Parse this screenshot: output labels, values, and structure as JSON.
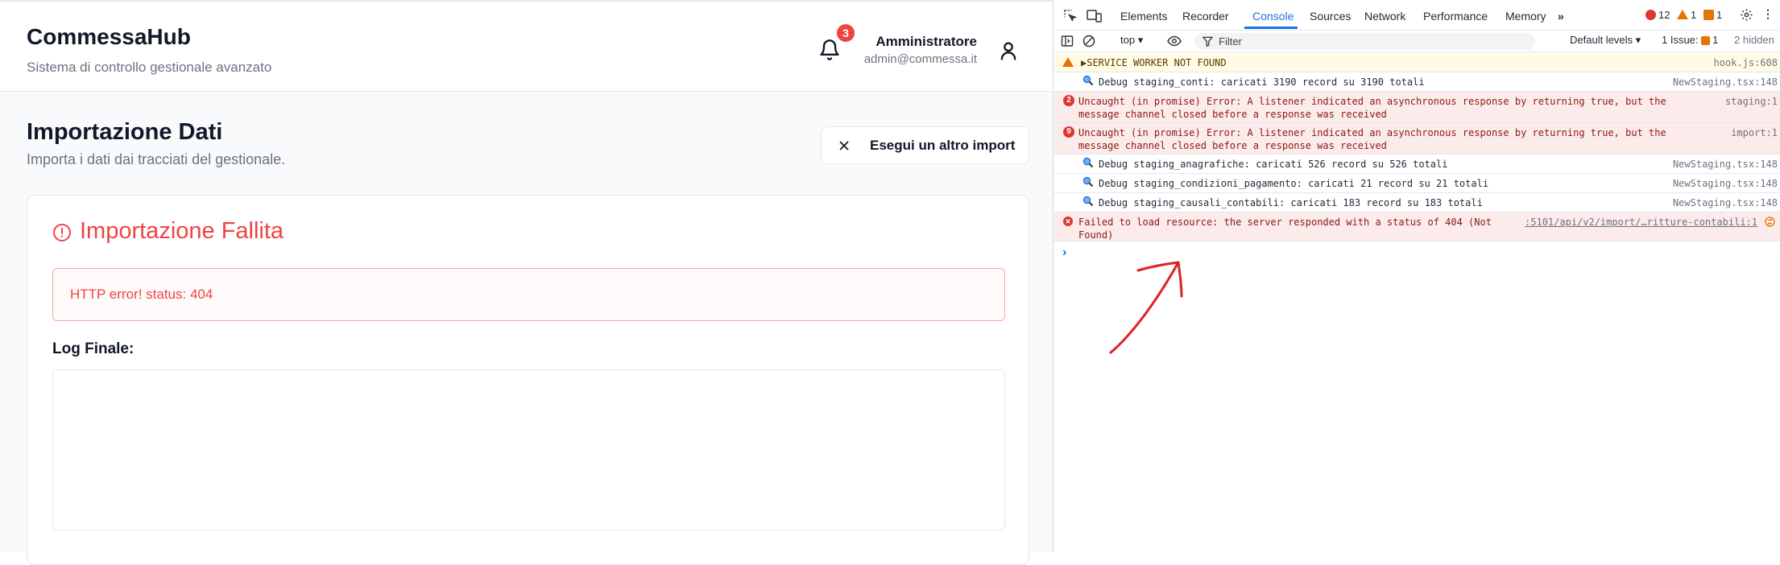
{
  "app": {
    "brand": "CommessaHub",
    "tagline": "Sistema di controllo gestionale avanzato",
    "notifications": "3",
    "user": {
      "name": "Amministratore",
      "email": "admin@commessa.it"
    },
    "page": {
      "title": "Importazione Dati",
      "subtitle": "Importa i dati dai tracciati del gestionale.",
      "rerun_button": "Esegui un altro import"
    },
    "result": {
      "title": "Importazione Fallita",
      "error": "HTTP error! status: 404",
      "log_label": "Log Finale:",
      "log": ""
    }
  },
  "devtools": {
    "tabs": [
      "Elements",
      "Recorder",
      "Console",
      "Sources",
      "Network",
      "Performance",
      "Memory"
    ],
    "active_tab": "Console",
    "counts": {
      "errors": "12",
      "warnings": "1",
      "issues": "1"
    },
    "context": "top",
    "filter_placeholder": "Filter",
    "levels": "Default levels",
    "issues_label": "1 Issue:",
    "issues_count": "1",
    "hidden": "2 hidden",
    "messages": [
      {
        "type": "warning",
        "text": "▶SERVICE WORKER NOT FOUND",
        "source": "hook.js:608"
      },
      {
        "type": "debug",
        "text": "Debug staging_conti: caricati 3190 record su 3190 totali",
        "source": "NewStaging.tsx:148"
      },
      {
        "type": "error",
        "count": "2",
        "text": "Uncaught (in promise) Error: A listener indicated an asynchronous response by returning true, but the message channel closed before a response was received",
        "source": "staging:1"
      },
      {
        "type": "error",
        "count": "9",
        "text": "Uncaught (in promise) Error: A listener indicated an asynchronous response by returning true, but the message channel closed before a response was received",
        "source": "import:1"
      },
      {
        "type": "debug",
        "text": "Debug staging_anagrafiche: caricati 526 record su 526 totali",
        "source": "NewStaging.tsx:148"
      },
      {
        "type": "debug",
        "text": "Debug staging_condizioni_pagamento: caricati 21 record su 21 totali",
        "source": "NewStaging.tsx:148"
      },
      {
        "type": "debug",
        "text": "Debug staging_causali_contabili: caricati 183 record su 183 totali",
        "source": "NewStaging.tsx:148"
      },
      {
        "type": "error",
        "text": "Failed to load resource: the server responded with a status of 404 (Not Found)",
        "source": ":5101/api/v2/import/…ritture-contabili:1"
      }
    ],
    "prompt": "›"
  }
}
